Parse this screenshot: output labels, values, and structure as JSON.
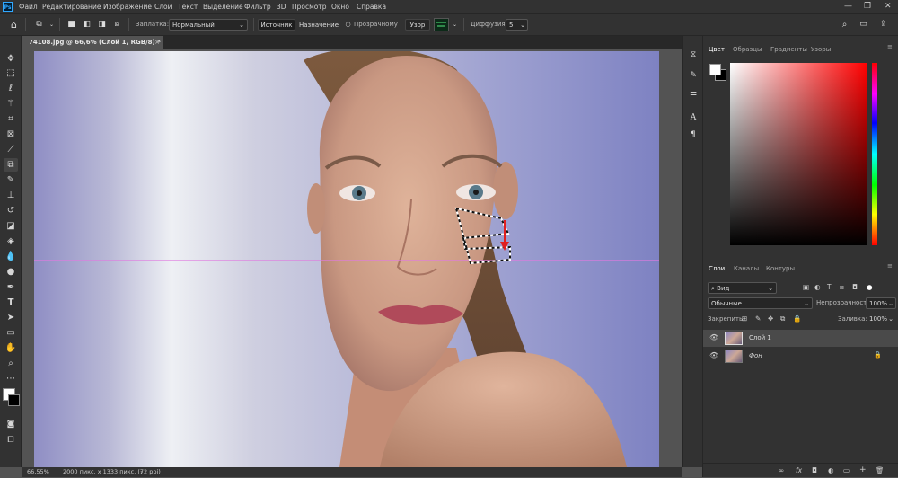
{
  "menubar": {
    "app_icon": "Ps",
    "items": [
      "Файл",
      "Редактирование",
      "Изображение",
      "Слои",
      "Текст",
      "Выделение",
      "Фильтр",
      "3D",
      "Просмотр",
      "Окно",
      "Справка"
    ],
    "window_controls": [
      "—",
      "❐",
      "✕"
    ]
  },
  "options": {
    "patch_label": "Заплатка:",
    "patch_mode": "Нормальный",
    "source_btn": "Источник",
    "dest_btn": "Назначение",
    "transparent_label": "Прозрачному",
    "pattern_btn": "Узор",
    "diffusion_label": "Диффузия:",
    "diffusion_value": "5"
  },
  "document": {
    "tab_title": "74108.jpg @ 66,6% (Слой 1, RGB/8) *",
    "tab_close": "×",
    "zoom": "66,55%",
    "info": "2000 пикс. x 1333 пикс. (72 ppi)"
  },
  "panels": {
    "color_tabs": [
      "Цвет",
      "Образцы",
      "Градиенты",
      "Узоры"
    ],
    "layer_tabs": [
      "Слои",
      "Каналы",
      "Контуры"
    ],
    "filter_kind": "Вид",
    "blend_mode": "Обычные",
    "opacity_label": "Непрозрачность:",
    "opacity_value": "100%",
    "lock_label": "Закрепить:",
    "fill_label": "Заливка:",
    "fill_value": "100%",
    "layers": [
      {
        "name": "Слой 1",
        "selected": true
      },
      {
        "name": "Фон",
        "selected": false
      }
    ],
    "bottom_icons": [
      "∞",
      "fx",
      "◘",
      "◐",
      "▭",
      "+",
      "🗑"
    ]
  },
  "guide_color": "#e07ae0",
  "accent": "#31a8ff"
}
